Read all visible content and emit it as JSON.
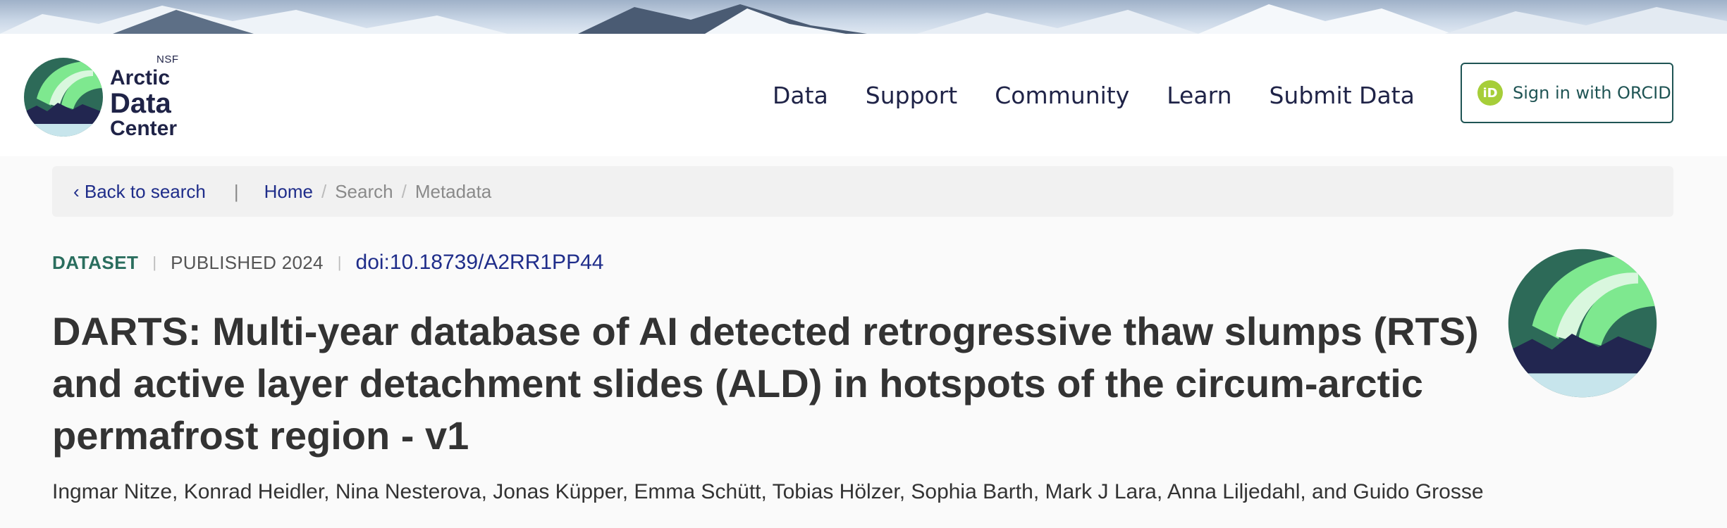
{
  "brand": {
    "nsf": "NSF",
    "line1": "Arctic",
    "line2": "Data",
    "line3": "Center"
  },
  "nav": {
    "items": [
      {
        "label": "Data"
      },
      {
        "label": "Support"
      },
      {
        "label": "Community"
      },
      {
        "label": "Learn"
      },
      {
        "label": "Submit Data"
      }
    ],
    "signin_label": "Sign in with ORCID",
    "signin_icon_text": "iD"
  },
  "breadcrumb": {
    "back_label": "‹ Back to search",
    "divider": "|",
    "items": [
      {
        "label": "Home"
      },
      {
        "label": "Search"
      },
      {
        "label": "Metadata"
      }
    ],
    "separator": "/"
  },
  "dataset": {
    "type_label": "DATASET",
    "published_label": "PUBLISHED 2024",
    "doi": "doi:10.18739/A2RR1PP44",
    "title": "DARTS: Multi-year database of AI detected retrogressive thaw slumps (RTS) and active layer detachment slides (ALD) in hotspots of the circum-arctic permafrost region - v1",
    "authors": "Ingmar Nitze, Konrad Heidler, Nina Nesterova, Jonas Küpper, Emma Schütt, Tobias Hölzer, Sophia Barth, Mark J Lara, Anna Liljedahl, and Guido Grosse"
  },
  "colors": {
    "navy": "#1f2347",
    "link": "#1f2d8a",
    "teal": "#2a6e5e",
    "orcid_green": "#a6ce39",
    "aurora_light": "#7ee88f",
    "aurora_dark": "#2d6a58"
  }
}
